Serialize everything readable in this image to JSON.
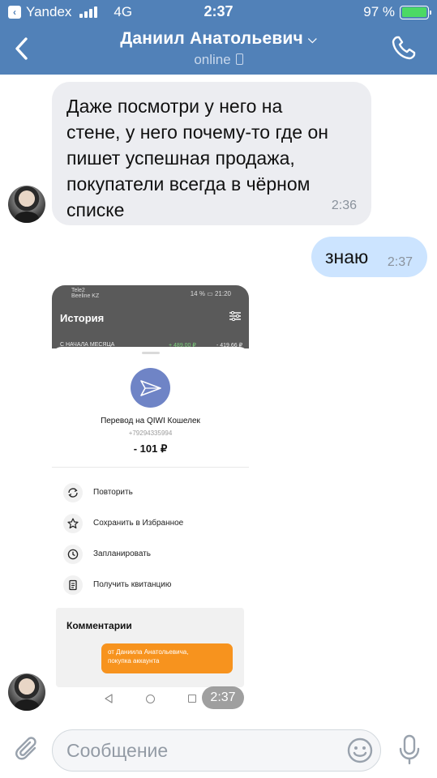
{
  "status_bar": {
    "carrier": "Yandex",
    "network": "4G",
    "time": "2:37",
    "battery_percent": "97 %",
    "battery_level": 0.97
  },
  "header": {
    "title": "Даниил Анатольевич",
    "status": "online",
    "accent_color": "#5181b8"
  },
  "messages": [
    {
      "direction": "incoming",
      "lines": [
        "Даже посмотри у него на",
        "стене, у него почему-то где он",
        "пишет успешная продажа,",
        "покупатели всегда в чёрном",
        "списке"
      ],
      "time": "2:36"
    },
    {
      "direction": "outgoing",
      "text": "знаю",
      "time": "2:37"
    },
    {
      "direction": "incoming",
      "type": "image",
      "time": "2:37",
      "screenshot": {
        "status_carrier_1": "Tele2",
        "status_carrier_2": "Beeline KZ",
        "status_right": "14 % ▭ 21:20",
        "screen_title": "История",
        "row_label": "С НАЧАЛА МЕСЯЦА",
        "row_income": "+ 489,00 ₽",
        "row_expense": "- 419,66 ₽",
        "transfer_title": "Перевод на QIWI Кошелек",
        "transfer_phone": "+79294335994",
        "transfer_amount": "- 101 ₽",
        "actions": [
          "Повторить",
          "Сохранить в Избранное",
          "Запланировать",
          "Получить квитанцию"
        ],
        "comments_title": "Комментарии",
        "comment_lines": [
          "от Даниила Анатольевича,",
          "покупка аккаунта"
        ]
      }
    }
  ],
  "composer": {
    "placeholder": "Сообщение"
  },
  "icons": [
    "back-chevron-icon",
    "phone-call-icon",
    "paperclip-icon",
    "emoji-icon",
    "microphone-icon"
  ]
}
